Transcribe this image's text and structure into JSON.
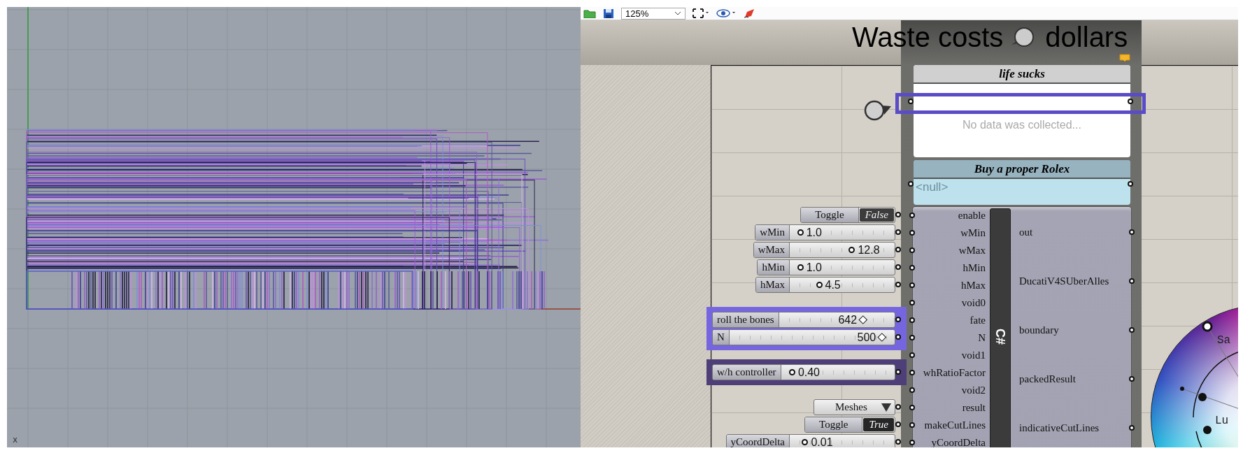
{
  "viewport": {
    "axis_label": "x"
  },
  "toolbar": {
    "zoom": "125%"
  },
  "group": {
    "title_left": "Waste costs",
    "title_right": "dollars"
  },
  "panels": [
    {
      "kind": "empty",
      "title": "life sucks",
      "text": "No data was collected..."
    },
    {
      "kind": "null",
      "title": "Buy a proper Rolex",
      "text": "<null>"
    }
  ],
  "component": {
    "name": "C#",
    "inputs": [
      {
        "name": "enable",
        "source": {
          "kind": "toggle",
          "label": "Toggle",
          "value": "False",
          "on": false
        }
      },
      {
        "name": "wMin",
        "source": {
          "kind": "slider",
          "label": "wMin",
          "value": "1.0",
          "level": 0.05
        }
      },
      {
        "name": "wMax",
        "source": {
          "kind": "slider",
          "label": "wMax",
          "value": "12.8",
          "level": 0.6
        }
      },
      {
        "name": "hMin",
        "source": {
          "kind": "slider",
          "label": "hMin",
          "value": "1.0",
          "level": 0.05
        }
      },
      {
        "name": "hMax",
        "source": {
          "kind": "slider",
          "label": "hMax",
          "value": "4.5",
          "level": 0.25
        }
      },
      {
        "name": "void0"
      },
      {
        "name": "fate",
        "source": {
          "kind": "int_slider",
          "label": "roll the bones",
          "value": "642",
          "level": 0.76,
          "color": "#7566e0"
        }
      },
      {
        "name": "N",
        "source": {
          "kind": "int_slider",
          "label": "N",
          "value": "500",
          "level": 0.96,
          "color": "#7566e0"
        }
      },
      {
        "name": "void1"
      },
      {
        "name": "whRatioFactor",
        "source": {
          "kind": "slider",
          "label": "w/h controller",
          "value": "0.40",
          "level": 0.05,
          "color": "#4f3f78"
        }
      },
      {
        "name": "void2"
      },
      {
        "name": "result",
        "source": {
          "kind": "dropdown",
          "label": "Meshes"
        }
      },
      {
        "name": "makeCutLines",
        "source": {
          "kind": "toggle",
          "label": "Toggle",
          "value": "True",
          "on": true
        }
      },
      {
        "name": "yCoordDelta",
        "source": {
          "kind": "slider",
          "label": "yCoordDelta",
          "value": "0.01",
          "level": 0.1
        }
      }
    ],
    "outputs": [
      "out",
      "DucatiV4SUberAlles",
      "boundary",
      "packedResult",
      "indicativeCutLines"
    ]
  },
  "color_wheel": {
    "labels": [
      "Sa",
      "Lu"
    ]
  }
}
